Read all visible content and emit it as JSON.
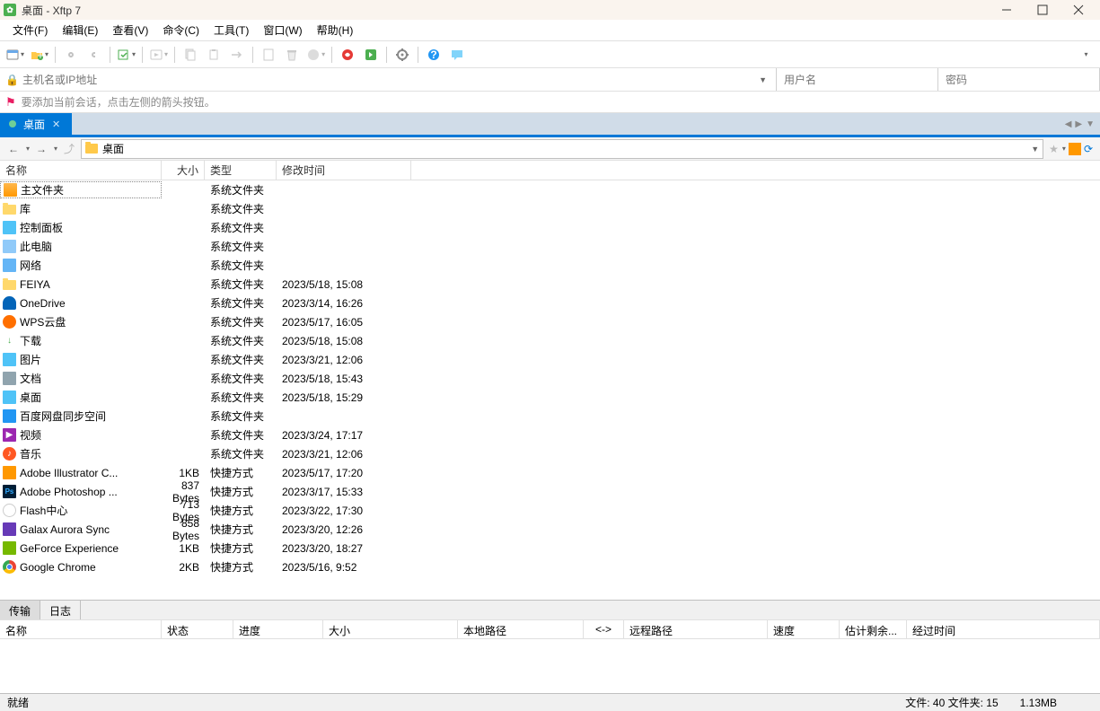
{
  "window": {
    "title": "桌面 - Xftp 7"
  },
  "menu": {
    "file": "文件(F)",
    "edit": "编辑(E)",
    "view": "查看(V)",
    "command": "命令(C)",
    "tool": "工具(T)",
    "window": "窗口(W)",
    "help": "帮助(H)"
  },
  "connbar": {
    "host_placeholder": "主机名或IP地址",
    "user_placeholder": "用户名",
    "pass_placeholder": "密码"
  },
  "tipbar": {
    "text": "要添加当前会话，点击左侧的箭头按钮。"
  },
  "tab": {
    "label": "桌面"
  },
  "nav": {
    "path": "桌面"
  },
  "columns": {
    "name": "名称",
    "size": "大小",
    "type": "类型",
    "modified": "修改时间"
  },
  "files": [
    {
      "icon": "ic-home",
      "name": "主文件夹",
      "size": "",
      "type": "系统文件夹",
      "mod": "",
      "selected": true
    },
    {
      "icon": "ic-folder",
      "name": "库",
      "size": "",
      "type": "系统文件夹",
      "mod": ""
    },
    {
      "icon": "ic-cpl",
      "name": "控制面板",
      "size": "",
      "type": "系统文件夹",
      "mod": ""
    },
    {
      "icon": "ic-pc",
      "name": "此电脑",
      "size": "",
      "type": "系统文件夹",
      "mod": ""
    },
    {
      "icon": "ic-net",
      "name": "网络",
      "size": "",
      "type": "系统文件夹",
      "mod": ""
    },
    {
      "icon": "ic-folder",
      "name": "FEIYA",
      "size": "",
      "type": "系统文件夹",
      "mod": "2023/5/18, 15:08"
    },
    {
      "icon": "ic-cloud",
      "name": "OneDrive",
      "size": "",
      "type": "系统文件夹",
      "mod": "2023/3/14, 16:26"
    },
    {
      "icon": "ic-wps",
      "name": "WPS云盘",
      "size": "",
      "type": "系统文件夹",
      "mod": "2023/5/17, 16:05"
    },
    {
      "icon": "ic-down",
      "name": "下载",
      "size": "",
      "type": "系统文件夹",
      "mod": "2023/5/18, 15:08"
    },
    {
      "icon": "ic-img",
      "name": "图片",
      "size": "",
      "type": "系统文件夹",
      "mod": "2023/3/21, 12:06"
    },
    {
      "icon": "ic-doc",
      "name": "文档",
      "size": "",
      "type": "系统文件夹",
      "mod": "2023/5/18, 15:43"
    },
    {
      "icon": "ic-desk",
      "name": "桌面",
      "size": "",
      "type": "系统文件夹",
      "mod": "2023/5/18, 15:29"
    },
    {
      "icon": "ic-baidu",
      "name": "百度网盘同步空间",
      "size": "",
      "type": "系统文件夹",
      "mod": ""
    },
    {
      "icon": "ic-vid",
      "name": "视频",
      "size": "",
      "type": "系统文件夹",
      "mod": "2023/3/24, 17:17"
    },
    {
      "icon": "ic-music",
      "name": "音乐",
      "size": "",
      "type": "系统文件夹",
      "mod": "2023/3/21, 12:06"
    },
    {
      "icon": "ic-ai",
      "name": "Adobe Illustrator C...",
      "size": "1KB",
      "type": "快捷方式",
      "mod": "2023/5/17, 17:20"
    },
    {
      "icon": "ic-ps",
      "name": "Adobe Photoshop ...",
      "size": "837 Bytes",
      "type": "快捷方式",
      "mod": "2023/3/17, 15:33"
    },
    {
      "icon": "ic-flash",
      "name": "Flash中心",
      "size": "713 Bytes",
      "type": "快捷方式",
      "mod": "2023/3/22, 17:30"
    },
    {
      "icon": "ic-galax",
      "name": "Galax Aurora Sync",
      "size": "858 Bytes",
      "type": "快捷方式",
      "mod": "2023/3/20, 12:26"
    },
    {
      "icon": "ic-nvidia",
      "name": "GeForce Experience",
      "size": "1KB",
      "type": "快捷方式",
      "mod": "2023/3/20, 18:27"
    },
    {
      "icon": "ic-chrome",
      "name": "Google Chrome",
      "size": "2KB",
      "type": "快捷方式",
      "mod": "2023/5/16, 9:52"
    }
  ],
  "bottom_tabs": {
    "transfer": "传输",
    "log": "日志"
  },
  "transfer_cols": {
    "name": "名称",
    "status": "状态",
    "progress": "进度",
    "size": "大小",
    "local": "本地路径",
    "arrow": "<->",
    "remote": "远程路径",
    "speed": "速度",
    "eta": "估计剩余...",
    "elapsed": "经过时间"
  },
  "status": {
    "ready": "就绪",
    "counts": "文件: 40 文件夹: 15",
    "size": "1.13MB"
  }
}
